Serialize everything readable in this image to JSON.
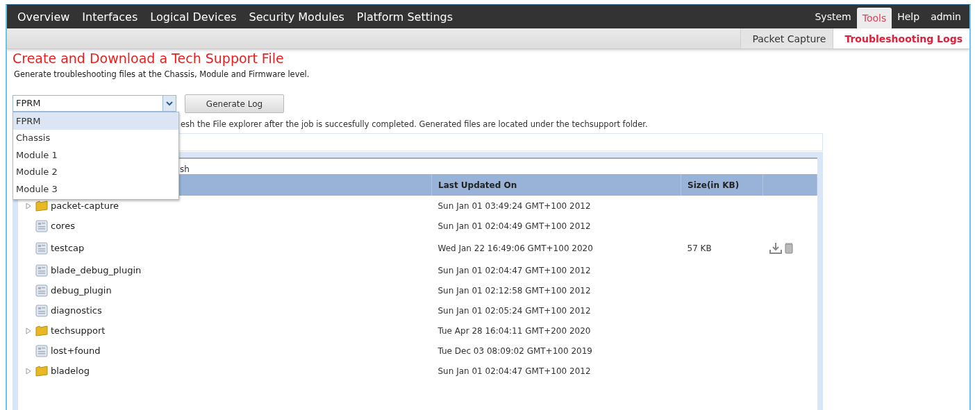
{
  "nav": {
    "left_items": [
      {
        "label": "Overview",
        "selected": false
      },
      {
        "label": "Interfaces",
        "selected": false
      },
      {
        "label": "Logical Devices",
        "selected": false
      },
      {
        "label": "Security Modules",
        "selected": false
      },
      {
        "label": "Platform Settings",
        "selected": false
      }
    ],
    "right_items": [
      {
        "label": "System",
        "selected": false
      },
      {
        "label": "Tools",
        "selected": true
      },
      {
        "label": "Help",
        "selected": false
      },
      {
        "label": "admin",
        "selected": false
      }
    ]
  },
  "subtabs": [
    {
      "label": "Packet Capture",
      "selected": false
    },
    {
      "label": "Troubleshooting Logs",
      "selected": true
    }
  ],
  "title": "Create and Download a Tech Support File",
  "subtitle": "Generate troubleshooting files at the Chassis, Module and Firmware level.",
  "component_select": {
    "value": "FPRM",
    "expanded": true,
    "options": [
      {
        "label": "FPRM",
        "selected": true
      },
      {
        "label": "Chassis",
        "selected": false
      },
      {
        "label": "Module 1",
        "selected": false
      },
      {
        "label": "Module 2",
        "selected": false
      },
      {
        "label": "Module 3",
        "selected": false
      }
    ]
  },
  "generate_button": "Generate Log",
  "note": "esh the File explorer after the job is succesfully completed. Generated files are located under the techsupport folder.",
  "explorer_toolbar_text": "sh",
  "table": {
    "columns": [
      {
        "label": "Last Updated On"
      },
      {
        "label": "Size(in KB)"
      }
    ],
    "rows": [
      {
        "name": "packet-capture",
        "kind": "folder",
        "expanded": false,
        "updated": "Sun Jan 01 03:49:24 GMT+100 2012",
        "has_actions": false
      },
      {
        "name": "cores",
        "kind": "file",
        "updated": "Sun Jan 01 02:04:49 GMT+100 2012",
        "has_actions": false
      },
      {
        "name": "testcap",
        "kind": "file",
        "updated": "Wed Jan 22 16:49:06 GMT+100 2020",
        "size": "57 KB",
        "has_actions": true
      },
      {
        "name": "blade_debug_plugin",
        "kind": "file",
        "updated": "Sun Jan 01 02:04:47 GMT+100 2012",
        "has_actions": false
      },
      {
        "name": "debug_plugin",
        "kind": "file",
        "updated": "Sun Jan 01 02:12:58 GMT+100 2012",
        "has_actions": false
      },
      {
        "name": "diagnostics",
        "kind": "file",
        "updated": "Sun Jan 01 02:05:24 GMT+100 2012",
        "has_actions": false
      },
      {
        "name": "techsupport",
        "kind": "folder",
        "expanded": false,
        "updated": "Tue Apr 28 16:04:11 GMT+200 2020",
        "has_actions": false
      },
      {
        "name": "lost+found",
        "kind": "file",
        "updated": "Tue Dec 03 08:09:02 GMT+100 2019",
        "has_actions": false
      },
      {
        "name": "bladelog",
        "kind": "folder",
        "expanded": false,
        "updated": "Sun Jan 01 02:04:47 GMT+100 2012",
        "has_actions": false
      }
    ]
  }
}
